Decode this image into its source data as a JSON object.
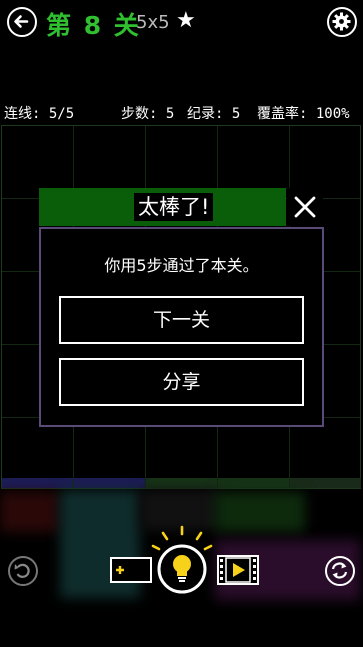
{
  "header": {
    "level_title": "第 8 关",
    "board_size": "5x5",
    "star": "★"
  },
  "stats": {
    "connections": "连线: 5/5",
    "steps": "步数: 5",
    "record": "纪录: 5",
    "coverage": "覆盖率: 100%"
  },
  "dialog": {
    "title": "太棒了!",
    "message": "你用5步通过了本关。",
    "next_label": "下一关",
    "share_label": "分享"
  },
  "colors": {
    "title_green": "#2fbf2f",
    "dialog_header": "#0a5e0a",
    "dialog_border": "#5a4a78",
    "hint_yellow": "#f7d21b"
  },
  "icons": {
    "back": "back-arrow-icon",
    "settings": "gear-icon",
    "undo": "undo-icon",
    "restart": "refresh-icon",
    "hint": "lightbulb-icon",
    "add_hint": "add-battery-icon",
    "video": "video-film-icon"
  }
}
